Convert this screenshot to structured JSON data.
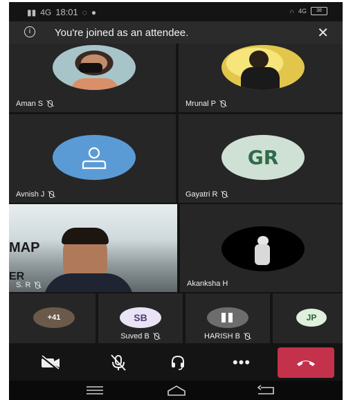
{
  "status_bar": {
    "time": "18:01",
    "network_left": "4G",
    "network_right": "4G",
    "battery": "38"
  },
  "banner": {
    "message": "You're joined as an attendee."
  },
  "participants": [
    {
      "name": "Aman S"
    },
    {
      "name": "Mrunal P"
    },
    {
      "name": "Avnish J"
    },
    {
      "name": "Gayatri R",
      "initials": "GR"
    },
    {
      "name": "S. R"
    },
    {
      "name": "Akanksha H"
    }
  ],
  "strip": [
    {
      "label": "+41"
    },
    {
      "initials": "SB",
      "name": "Suved B"
    },
    {
      "name": "HARISH B"
    },
    {
      "initials": "JP"
    }
  ],
  "video_overlay_text": {
    "line1": "MAP",
    "line2": "ER"
  },
  "colors": {
    "hangup": "#c4314b",
    "avnish_avatar": "#5b9bd5",
    "gr_avatar": "#cfe0d4",
    "gr_text": "#2f6b4a"
  }
}
